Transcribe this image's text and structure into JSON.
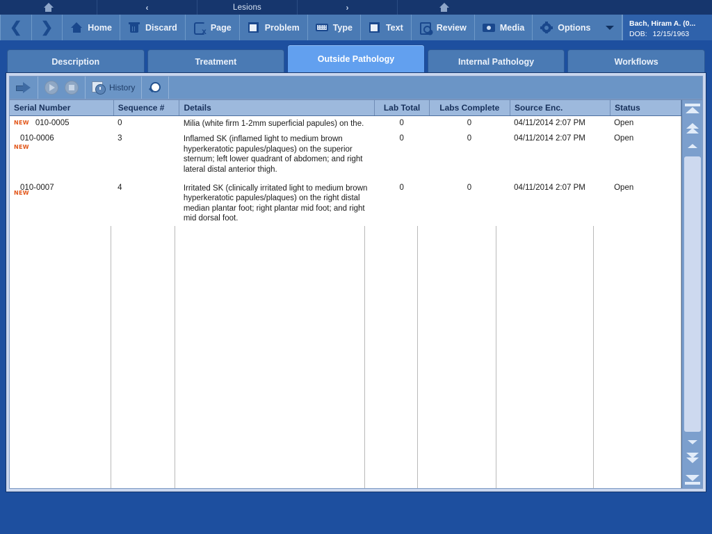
{
  "titlebar": {
    "home_icon": "home-icon",
    "prev_chevron": "‹",
    "title": "Lesions",
    "next_chevron": "›",
    "home_icon2": "home-icon"
  },
  "toolbar": {
    "back_arrow": "❮",
    "forward_arrow": "❯",
    "buttons": [
      {
        "label": "Home",
        "icon": "home-icon"
      },
      {
        "label": "Discard",
        "icon": "trash-icon"
      },
      {
        "label": "Page",
        "icon": "page-close-icon"
      },
      {
        "label": "Problem",
        "icon": "square-icon"
      },
      {
        "label": "Type",
        "icon": "keyboard-icon"
      },
      {
        "label": "Text",
        "icon": "square-icon"
      },
      {
        "label": "Review",
        "icon": "review-magnifier-icon"
      },
      {
        "label": "Media",
        "icon": "camera-icon"
      },
      {
        "label": "Options",
        "icon": "gear-icon"
      }
    ],
    "options_caret": "chevron-down-icon"
  },
  "patient": {
    "name": "Bach, Hiram A. (0...",
    "dob_label": "DOB:",
    "dob_value": "12/15/1963"
  },
  "tabs": [
    {
      "label": "Description",
      "active": false
    },
    {
      "label": "Treatment",
      "active": false
    },
    {
      "label": "Outside Pathology",
      "active": true
    },
    {
      "label": "Internal Pathology",
      "active": false
    },
    {
      "label": "Workflows",
      "active": false
    }
  ],
  "inner_toolbar": {
    "forward_icon": "arrow-right-icon",
    "play_icon": "play-circle-icon",
    "stop_icon": "stop-circle-icon",
    "history_label": "History",
    "history_icon": "clock-history-icon",
    "search_icon": "magnifier-icon"
  },
  "table": {
    "columns": [
      {
        "key": "serial",
        "label": "Serial Number",
        "align": "left"
      },
      {
        "key": "sequence",
        "label": "Sequence #",
        "align": "left"
      },
      {
        "key": "details",
        "label": "Details",
        "align": "left"
      },
      {
        "key": "labtotal",
        "label": "Lab Total",
        "align": "center"
      },
      {
        "key": "labsdone",
        "label": "Labs Complete",
        "align": "center"
      },
      {
        "key": "source",
        "label": "Source Enc.",
        "align": "left"
      },
      {
        "key": "status",
        "label": "Status",
        "align": "left"
      }
    ],
    "rows": [
      {
        "badge": "NEW",
        "serial": "010-0005",
        "sequence": "0",
        "details": "Milia (white firm 1-2mm superficial papules) on the.",
        "labtotal": "0",
        "labsdone": "0",
        "source": "04/11/2014 2:07 PM",
        "status": "Open"
      },
      {
        "badge": "NEW",
        "serial": "010-0006",
        "sequence": "3",
        "details": "Inflamed SK (inflamed light to medium brown hyperkeratotic papules/plaques) on the superior sternum; left lower quadrant of abdomen; and right lateral distal anterior thigh.",
        "labtotal": "0",
        "labsdone": "0",
        "source": "04/11/2014 2:07 PM",
        "status": "Open"
      },
      {
        "badge": "NEW",
        "serial": "010-0007",
        "sequence": "4",
        "details": "Irritated SK (clinically irritated light to medium brown hyperkeratotic papules/plaques) on the right distal median plantar foot; right plantar mid foot; and right mid dorsal foot.",
        "labtotal": "0",
        "labsdone": "0",
        "source": "04/11/2014 2:07 PM",
        "status": "Open"
      }
    ]
  },
  "scrollbar": {
    "top_full_icon": "scroll-to-top-icon",
    "page_up_icon": "page-up-double-chevron-icon",
    "line_up_icon": "line-up-arrow-icon",
    "line_down_icon": "line-down-arrow-icon",
    "page_down_icon": "page-down-double-chevron-icon",
    "bottom_full_icon": "scroll-to-bottom-icon"
  },
  "colors": {
    "app_background": "#1d4f9f",
    "titlebar": "#16366d",
    "toolbar": "#4a7ab4",
    "active_tab": "#62a0ef",
    "inactive_tab": "#4a7ab4",
    "panel": "#c9d6ee",
    "header_row": "#9db9dd",
    "new_badge": "#e2571a",
    "grid_background": "#ffffff"
  }
}
